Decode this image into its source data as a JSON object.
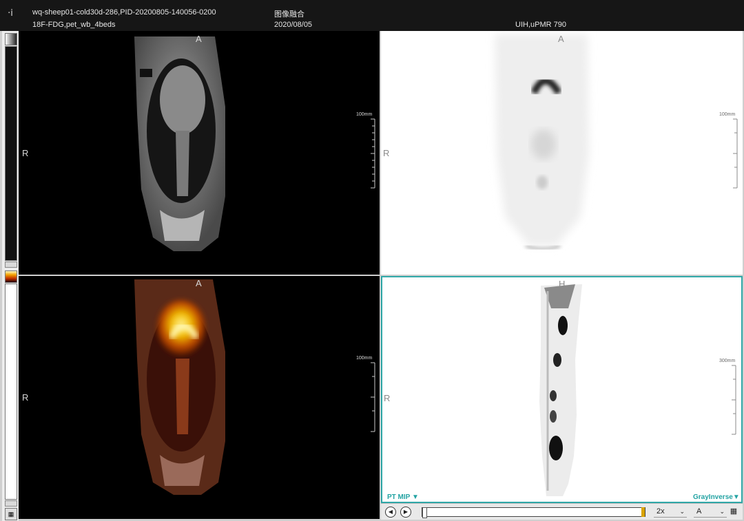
{
  "header": {
    "line1_left": "wq-sheep01-cold30d-286,PID-20200805-140056-0200",
    "line1_center": "图像融合",
    "line2_left": "18F-FDG,pet_wb_4beds",
    "line2_center": "2020/08/05",
    "line2_right": "UIH,uPMR 790"
  },
  "viewports": {
    "mr_coronal": {
      "top_orient": "A",
      "left_orient": "R",
      "scale": "100mm"
    },
    "pet_coronal": {
      "top_orient": "A",
      "left_orient": "R",
      "scale": "100mm"
    },
    "fusion_coronal": {
      "top_orient": "A",
      "left_orient": "R",
      "scale": "100mm"
    },
    "pt_mip": {
      "top_orient": "H",
      "left_orient": "R",
      "scale": "300mm",
      "mode": "PT MIP",
      "lut": "GrayInverse"
    }
  },
  "cine": {
    "speed": "2x",
    "axis": "A",
    "progress": 1.0
  },
  "colors": {
    "accent": "#2fa8a8",
    "slider_marker": "#d9a300",
    "pet_hot": "#f4c200"
  },
  "icons": [
    "info-icon",
    "play-back-icon",
    "play-forward-icon",
    "chevron-down-icon",
    "calendar-icon",
    "grayscale-swatch-icon",
    "hot-colormap-swatch-icon"
  ]
}
